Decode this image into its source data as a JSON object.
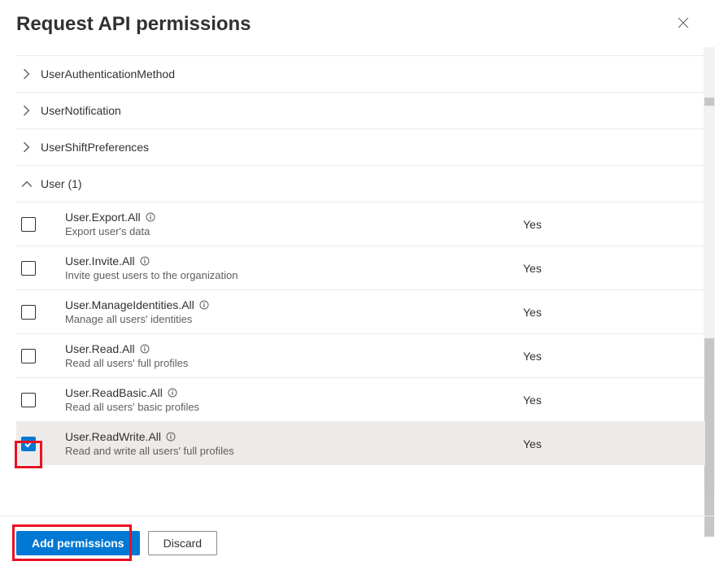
{
  "header": {
    "title": "Request API permissions"
  },
  "sections": {
    "userAuthMethod": "UserAuthenticationMethod",
    "userNotification": "UserNotification",
    "userShiftPref": "UserShiftPreferences",
    "user": "User (1)"
  },
  "permissions": [
    {
      "name": "User.Export.All",
      "desc": "Export user's data",
      "admin": "Yes",
      "checked": false
    },
    {
      "name": "User.Invite.All",
      "desc": "Invite guest users to the organization",
      "admin": "Yes",
      "checked": false
    },
    {
      "name": "User.ManageIdentities.All",
      "desc": "Manage all users' identities",
      "admin": "Yes",
      "checked": false
    },
    {
      "name": "User.Read.All",
      "desc": "Read all users' full profiles",
      "admin": "Yes",
      "checked": false
    },
    {
      "name": "User.ReadBasic.All",
      "desc": "Read all users' basic profiles",
      "admin": "Yes",
      "checked": false
    },
    {
      "name": "User.ReadWrite.All",
      "desc": "Read and write all users' full profiles",
      "admin": "Yes",
      "checked": true
    }
  ],
  "footer": {
    "add": "Add permissions",
    "discard": "Discard"
  }
}
